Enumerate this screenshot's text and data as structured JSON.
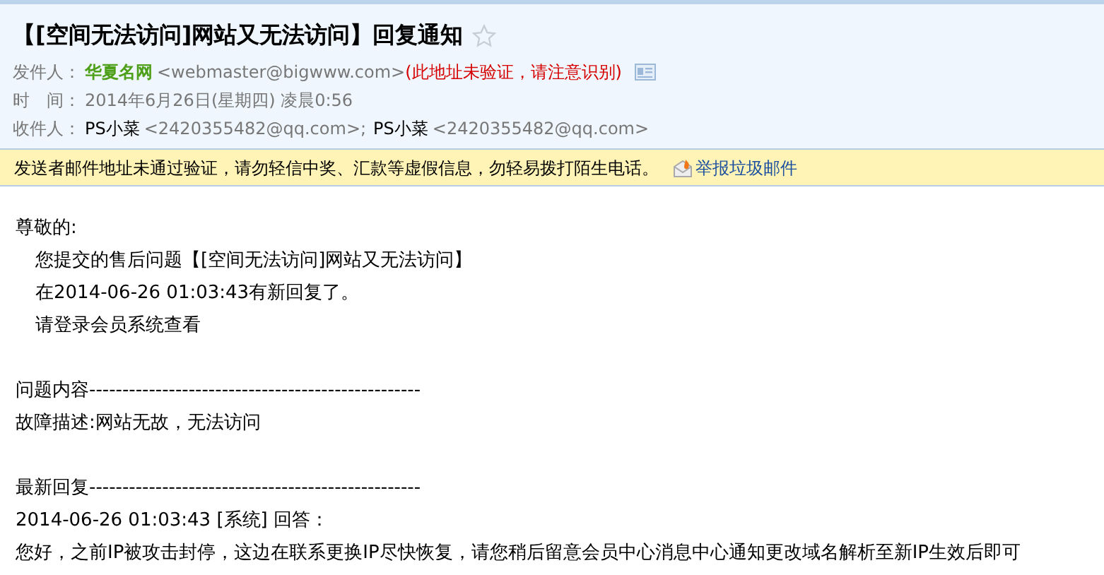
{
  "header": {
    "subject": "【[空间无法访问]网站又无法访问】回复通知",
    "starred": false,
    "from": {
      "label": "发件人：",
      "name": "华夏名网",
      "address": "<webmaster@bigwww.com>",
      "warning": "(此地址未验证，请注意识别)"
    },
    "time": {
      "label": "时　间：",
      "value": "2014年6月26日(星期四) 凌晨0:56"
    },
    "to": {
      "label": "收件人：",
      "recipients": [
        {
          "name": "PS小菜",
          "address": "<2420355482@qq.com>;"
        },
        {
          "name": "PS小菜",
          "address": "<2420355482@qq.com>"
        }
      ]
    }
  },
  "notice": {
    "text": "发送者邮件地址未通过验证，请勿轻信中奖、汇款等虚假信息，勿轻易拨打陌生电话。",
    "link": "举报垃圾邮件"
  },
  "body": [
    {
      "kind": "line",
      "text": "尊敬的:"
    },
    {
      "kind": "indent",
      "text": "您提交的售后问题【[空间无法访问]网站又无法访问】"
    },
    {
      "kind": "indent",
      "text": "在2014-06-26 01:03:43有新回复了。"
    },
    {
      "kind": "indent",
      "text": "请登录会员系统查看"
    },
    {
      "kind": "blank"
    },
    {
      "kind": "line",
      "text": "问题内容--------------------------------------------------"
    },
    {
      "kind": "line",
      "text": "故障描述:网站无故，无法访问"
    },
    {
      "kind": "blank"
    },
    {
      "kind": "line",
      "text": "最新回复--------------------------------------------------"
    },
    {
      "kind": "line",
      "text": "2014-06-26 01:03:43 [系统] 回答："
    },
    {
      "kind": "line",
      "text": "您好，之前IP被攻击封停，这边在联系更换IP尽快恢复，请您稍后留意会员中心消息中心通知更改域名解析至新IP生效后即可"
    }
  ]
}
